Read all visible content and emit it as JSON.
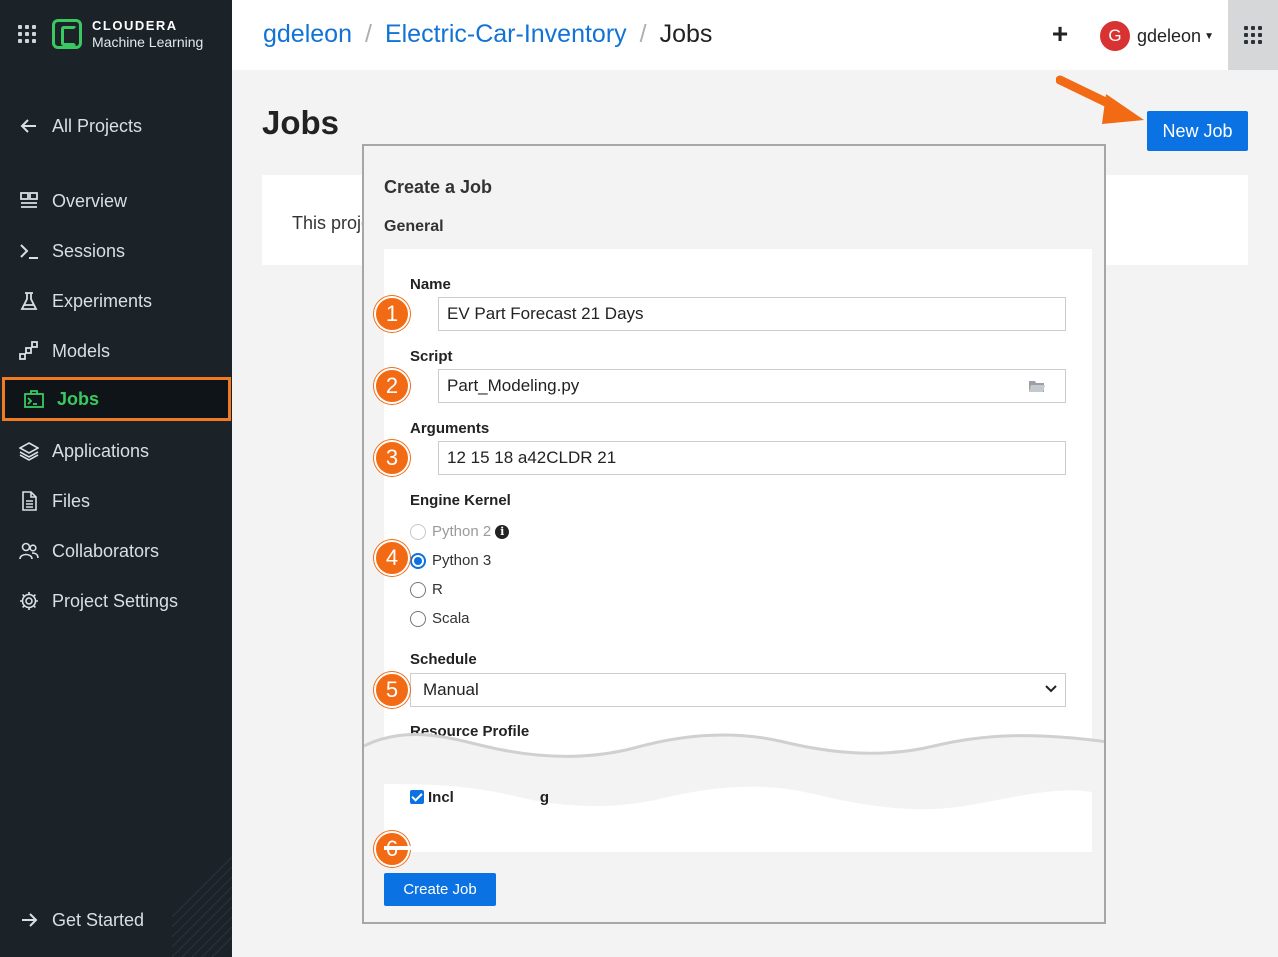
{
  "app": {
    "brand_line1": "CLOUDERA",
    "brand_line2": "Machine Learning"
  },
  "sidebar": {
    "back_label": "All Projects",
    "items": [
      {
        "label": "Overview",
        "icon": "overview-icon"
      },
      {
        "label": "Sessions",
        "icon": "terminal-icon"
      },
      {
        "label": "Experiments",
        "icon": "flask-icon"
      },
      {
        "label": "Models",
        "icon": "models-icon"
      },
      {
        "label": "Jobs",
        "icon": "jobs-icon",
        "active": true
      },
      {
        "label": "Applications",
        "icon": "layers-icon"
      },
      {
        "label": "Files",
        "icon": "file-icon"
      },
      {
        "label": "Collaborators",
        "icon": "users-icon"
      },
      {
        "label": "Project Settings",
        "icon": "gear-icon"
      }
    ],
    "footer_label": "Get Started"
  },
  "header": {
    "breadcrumb": [
      "gdeleon",
      "Electric-Car-Inventory",
      "Jobs"
    ],
    "separator": "/",
    "plus": "+",
    "user_initial": "G",
    "user_name": "gdeleon"
  },
  "main": {
    "title": "Jobs",
    "new_job_label": "New Job",
    "panel_text": "This proje"
  },
  "modal": {
    "title": "Create a Job",
    "section": "General",
    "name_label": "Name",
    "name_value": "EV Part Forecast 21 Days",
    "script_label": "Script",
    "script_value": "Part_Modeling.py",
    "arguments_label": "Arguments",
    "arguments_value": "12 15 18 a42CLDR 21",
    "kernel_label": "Engine Kernel",
    "kernels": [
      {
        "label": "Python 2",
        "state": "disabled"
      },
      {
        "label": "Python 3",
        "state": "checked"
      },
      {
        "label": "R",
        "state": "unchecked"
      },
      {
        "label": "Scala",
        "state": "unchecked"
      }
    ],
    "info_glyph": "i",
    "schedule_label": "Schedule",
    "schedule_value": "Manual",
    "resource_label": "Resource Profile",
    "checkbox_label_a": "Incl",
    "checkbox_label_b": "g",
    "create_label": "Create Job"
  },
  "badges": [
    "1",
    "2",
    "3",
    "4",
    "5",
    "6"
  ],
  "colors": {
    "accent": "#0a72e3",
    "badge": "#f26a14",
    "sidebar_bg": "#1b2329",
    "active_green": "#3ac960",
    "highlight_border": "#f07b22"
  }
}
